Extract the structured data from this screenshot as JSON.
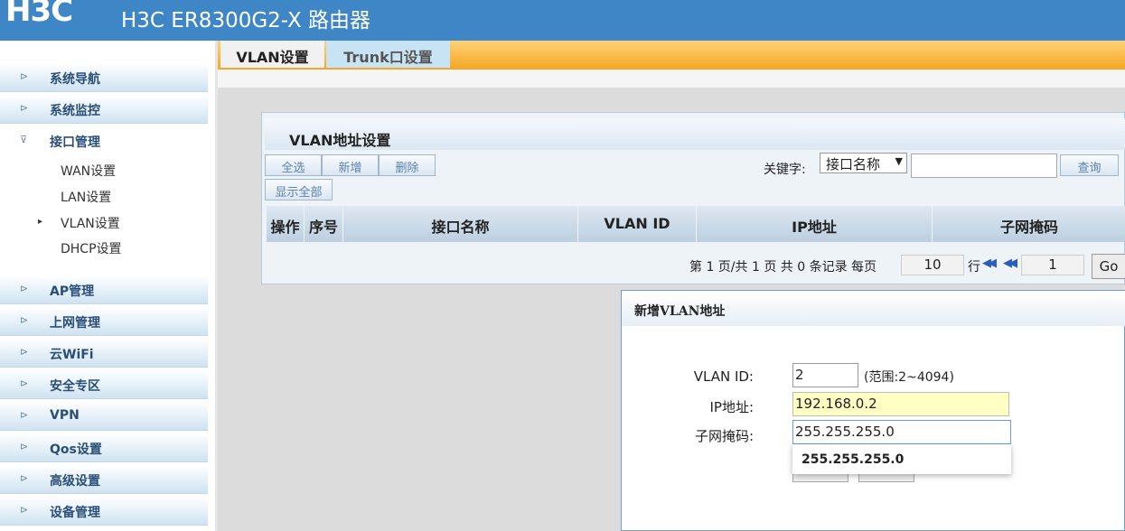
{
  "header": {
    "logo": "H3C",
    "title": "H3C ER8300G2-X 路由器"
  },
  "sidebar": {
    "items": [
      {
        "label": "系统导航"
      },
      {
        "label": "系统监控"
      },
      {
        "label": "接口管理"
      },
      {
        "label": "AP管理"
      },
      {
        "label": "上网管理"
      },
      {
        "label": "云WiFi"
      },
      {
        "label": "安全专区"
      },
      {
        "label": "VPN"
      },
      {
        "label": "Qos设置"
      },
      {
        "label": "高级设置"
      },
      {
        "label": "设备管理"
      }
    ],
    "sub_items": [
      {
        "label": "WAN设置"
      },
      {
        "label": "LAN设置"
      },
      {
        "label": "VLAN设置"
      },
      {
        "label": "DHCP设置"
      }
    ],
    "active_sub": "VLAN设置"
  },
  "tabs": [
    {
      "label": "VLAN设置",
      "active": true
    },
    {
      "label": "Trunk口设置",
      "active": false
    }
  ],
  "panel": {
    "title": "VLAN地址设置",
    "buttons": {
      "select_all": "全选",
      "add": "新增",
      "delete": "删除",
      "show_all": "显示全部",
      "query": "查询"
    },
    "keyword_label": "关键字:",
    "keyword_select": "接口名称",
    "keyword_value": "",
    "columns": [
      "操作",
      "序号",
      "接口名称",
      "VLAN ID",
      "IP地址",
      "子网掩码"
    ],
    "pager": {
      "summary": "第 1 页/共 1 页 共 0 条记录 每页",
      "page_size": "10",
      "row_label": "行",
      "page": "1",
      "go": "Go"
    }
  },
  "dialog": {
    "title": "新增VLAN地址",
    "vlan_id_label": "VLAN ID:",
    "vlan_id_value": "2",
    "vlan_id_hint": "(范围:2~4094)",
    "ip_label": "IP地址:",
    "ip_value": "192.168.0.2",
    "mask_label": "子网掩码:",
    "mask_value": "255.255.255.0",
    "autocomplete_option": "255.255.255.0"
  },
  "colors": {
    "header_bg": "#3f86c6",
    "tab_bar": "#f5a623",
    "ip_field_bg": "#ffffc4",
    "link_blue": "#5a82b0"
  }
}
